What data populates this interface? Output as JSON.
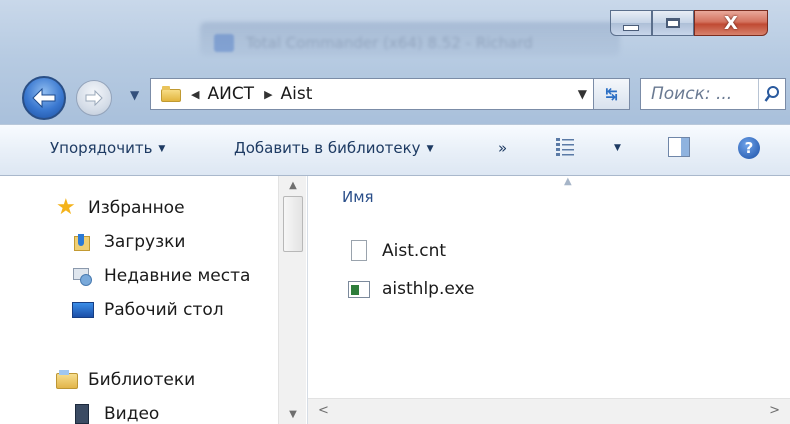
{
  "window": {
    "background_title": "Total Commander (x64) 8.52 - Richard",
    "controls": {
      "minimize": "",
      "maximize": "",
      "close": "X"
    }
  },
  "nav": {
    "breadcrumbs": [
      "АИСТ",
      "Aist"
    ],
    "search_placeholder": "Поиск: ..."
  },
  "toolbar": {
    "organize": "Упорядочить",
    "add_to_library": "Добавить в библиотеку",
    "more": "»"
  },
  "sidebar": {
    "items": [
      {
        "label": "Избранное",
        "icon": "star-icon"
      },
      {
        "label": "Загрузки",
        "icon": "downloads-icon"
      },
      {
        "label": "Недавние места",
        "icon": "recent-places-icon"
      },
      {
        "label": "Рабочий стол",
        "icon": "desktop-icon"
      },
      {
        "label": "Библиотеки",
        "icon": "libraries-icon"
      },
      {
        "label": "Видео",
        "icon": "video-icon"
      }
    ]
  },
  "files": {
    "column_name": "Имя",
    "items": [
      {
        "name": "Aist.cnt",
        "icon": "file-icon"
      },
      {
        "name": "aisthlp.exe",
        "icon": "exe-icon"
      }
    ]
  },
  "colors": {
    "accent": "#2b4f8a",
    "frame": "#b7cbe2"
  }
}
